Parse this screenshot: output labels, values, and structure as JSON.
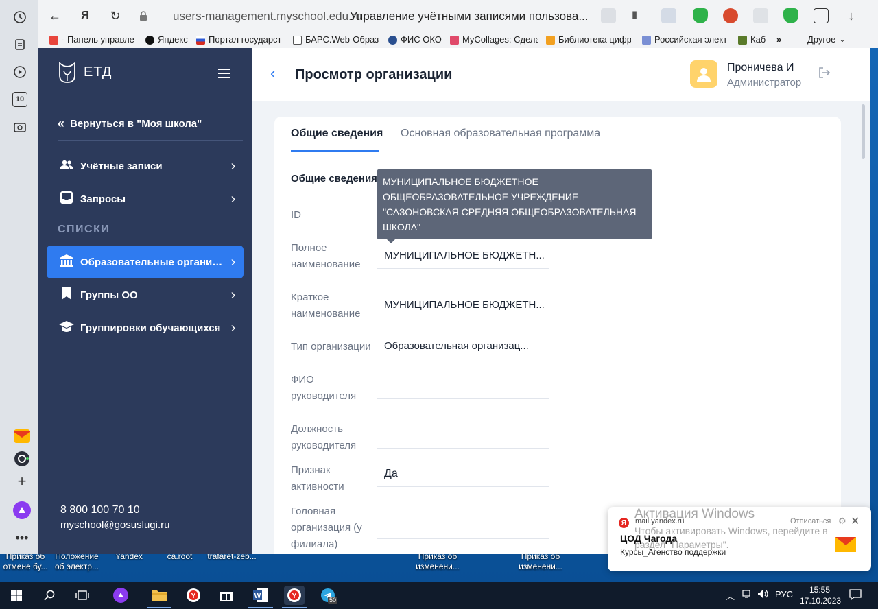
{
  "browser": {
    "url": "users-management.myschool.edu.ru",
    "tab_title": "Управление учётными записями пользова...",
    "bookmarks": [
      "- Панель управле",
      "Яндекс",
      "Портал государст",
      "БАРС.Web-Образо",
      "ФИС ОКО",
      "MyCollages: Сдела",
      "Библиотека цифр",
      "Российская элект",
      "Каб"
    ],
    "bookmarks_more": "»",
    "bookmarks_other": "Другое"
  },
  "leftbar": {
    "counter": "10"
  },
  "sidebar": {
    "logo": "ЕТД",
    "back_label": "Вернуться в \"Моя школа\"",
    "items": [
      {
        "label": "Учётные записи",
        "icon": "users-icon"
      },
      {
        "label": "Запросы",
        "icon": "inbox-icon"
      }
    ],
    "section": "СПИСКИ",
    "list_items": [
      {
        "label": "Образовательные организа...",
        "icon": "institution-icon",
        "active": true
      },
      {
        "label": "Группы ОО",
        "icon": "bookmark-icon"
      },
      {
        "label": "Группировки обучающихся",
        "icon": "graduation-icon"
      }
    ],
    "phone": "8 800 100 70 10",
    "email": "myschool@gosuslugi.ru"
  },
  "header": {
    "title": "Просмотр организации",
    "user_name": "Проничева И",
    "user_role": "Администратор"
  },
  "tabs": [
    "Общие сведения",
    "Основная образовательная программа"
  ],
  "form": {
    "section_title": "Общие сведения",
    "tooltip": "МУНИЦИПАЛЬНОЕ БЮДЖЕТНОЕ ОБЩЕОБРАЗОВАТЕЛЬНОЕ УЧРЕЖДЕНИЕ \"САЗОНОВСКАЯ СРЕДНЯЯ ОБЩЕОБРАЗОВАТЕЛЬНАЯ ШКОЛА\"",
    "fields": [
      {
        "label": "ID",
        "value": ""
      },
      {
        "label": "Полное наименование",
        "value": "МУНИЦИПАЛЬНОЕ БЮДЖЕТН..."
      },
      {
        "label": "Краткое наименование",
        "value": "МУНИЦИПАЛЬНОЕ БЮДЖЕТН..."
      },
      {
        "label": "Тип организации",
        "value": "Образовательная организац..."
      },
      {
        "label": "ФИО руководителя",
        "value": ""
      },
      {
        "label": "Должность руководителя",
        "value": ""
      },
      {
        "label": "Признак активности",
        "value": "Да"
      },
      {
        "label": "Головная организация (у филиала)",
        "value": ""
      }
    ]
  },
  "notification": {
    "watermark_title": "Активация Windows",
    "watermark_text": "Чтобы активировать Windows, перейдите в раздел \"Параметры\".",
    "source": "mail.yandex.ru",
    "unsubscribe": "Отписаться",
    "title": "ЦОД Чагода",
    "text": "Курсы_Агенство поддержки"
  },
  "desktop_icons": [
    "Приказ об отмене бу...",
    "Положение об электр...",
    "Yandex",
    "ca.root",
    "trafaret-zeb...",
    "Приказ об изменени...",
    "Приказ об изменени..."
  ],
  "taskbar": {
    "lang": "РУС",
    "time": "15:55",
    "date": "17.10.2023",
    "telegram_badge": "50"
  }
}
